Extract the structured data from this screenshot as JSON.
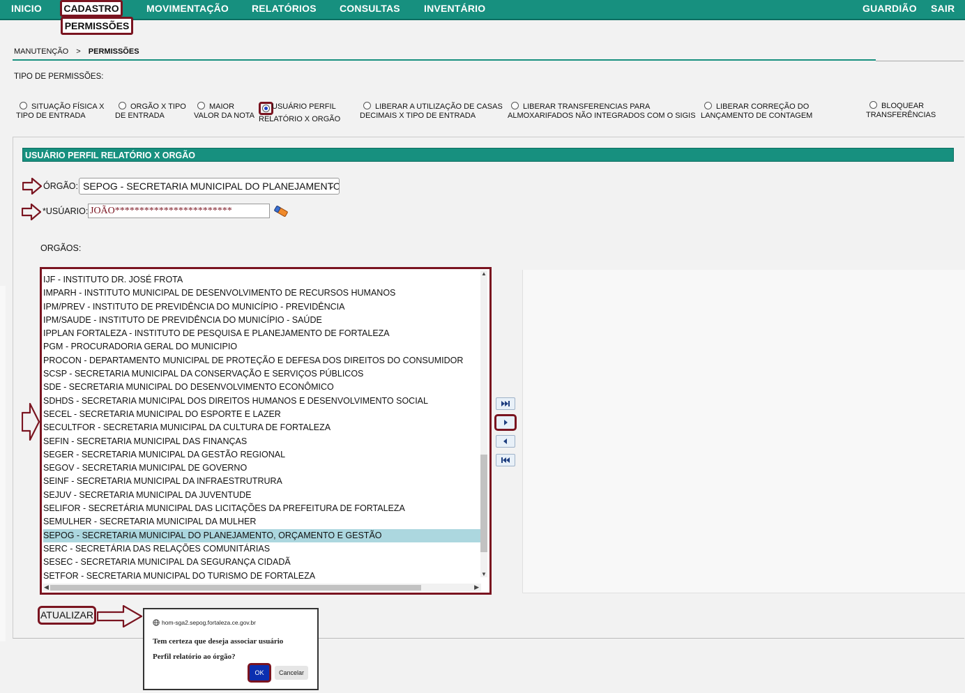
{
  "nav": {
    "items": [
      "INICIO",
      "CADASTRO",
      "MOVIMENTAÇÃO",
      "RELATÓRIOS",
      "CONSULTAS",
      "INVENTÁRIO"
    ],
    "right_items": [
      "GUARDIÃO",
      "SAIR"
    ],
    "submenu_item": "PERMISSÕES"
  },
  "breadcrumb": {
    "parent": "MANUTENÇÃO",
    "separator": ">",
    "current": "PERMISSÕES"
  },
  "permission_types": {
    "label": "TIPO DE PERMISSÕES:",
    "options": [
      {
        "line1": "SITUAÇÃO FÍSICA X",
        "line2": "TIPO DE ENTRADA",
        "checked": false
      },
      {
        "line1": "ORGÃO X TIPO",
        "line2": "DE ENTRADA",
        "checked": false
      },
      {
        "line1": "MAIOR",
        "line2": "VALOR DA NOTA",
        "checked": false
      },
      {
        "line1": "USUÁRIO PERFIL",
        "line2": "RELATÓRIO X ORGÃO",
        "checked": true
      },
      {
        "line1": "LIBERAR A UTILIZAÇÃO DE CASAS",
        "line2": "DECIMAIS X TIPO DE ENTRADA",
        "checked": false
      },
      {
        "line1": "LIBERAR TRANSFERENCIAS PARA",
        "line2": "ALMOXARIFADOS NÃO INTEGRADOS COM O SIGIS",
        "checked": false
      },
      {
        "line1": "LIBERAR CORREÇÃO DO",
        "line2": "LANÇAMENTO DE CONTAGEM",
        "checked": false
      },
      {
        "line1": "BLOQUEAR",
        "line2": "TRANSFERÊNCIAS",
        "checked": false
      }
    ]
  },
  "panel": {
    "title": "USUÁRIO PERFIL RELATÓRIO X ORGÃO",
    "orgao_label": "ÓRGÃO:",
    "orgao_value": "SEPOG - SECRETARIA MUNICIPAL DO PLANEJAMENTO, ORÇAMENTO E GESTÃO",
    "usuario_label": "*USÚARIO:",
    "usuario_value": "JOÃO************************",
    "orgaos_label": "ORGÃOS:",
    "orgaos_list": [
      "IJF - INSTITUTO DR. JOSÉ FROTA",
      "IMPARH - INSTITUTO MUNICIPAL DE DESENVOLVIMENTO DE RECURSOS HUMANOS",
      "IPM/PREV - INSTITUTO DE PREVIDÊNCIA DO MUNICÍPIO - PREVIDÊNCIA",
      "IPM/SAUDE - INSTITUTO DE PREVIDÊNCIA DO MUNICÍPIO - SAÚDE",
      "IPPLAN FORTALEZA - INSTITUTO DE PESQUISA E PLANEJAMENTO DE FORTALEZA",
      "PGM - PROCURADORIA GERAL DO MUNICIPIO",
      "PROCON - DEPARTAMENTO MUNICIPAL DE PROTEÇÃO E DEFESA DOS DIREITOS DO CONSUMIDOR",
      "SCSP - SECRETARIA MUNICIPAL DA CONSERVAÇÃO E SERVIÇOS PÚBLICOS",
      "SDE - SECRETARIA MUNICIPAL DO DESENVOLVIMENTO ECONÔMICO",
      "SDHDS - SECRETARIA MUNICIPAL DOS DIREITOS HUMANOS E DESENVOLVIMENTO SOCIAL",
      "SECEL - SECRETARIA MUNICIPAL DO ESPORTE E LAZER",
      "SECULTFOR - SECRETARIA MUNICIPAL DA CULTURA DE FORTALEZA",
      "SEFIN - SECRETARIA MUNICIPAL DAS FINANÇAS",
      "SEGER - SECRETARIA MUNICIPAL DA GESTÃO REGIONAL",
      "SEGOV - SECRETARIA MUNICIPAL DE GOVERNO",
      "SEINF - SECRETARIA MUNICIPAL DA INFRAESTRUTRURA",
      "SEJUV - SECRETARIA MUNICIPAL DA JUVENTUDE",
      "SELIFOR - SECRETÁRIA MUNICIPAL DAS LICITAÇÕES DA PREFEITURA DE FORTALEZA",
      "SEMULHER - SECRETARIA MUNICIPAL DA MULHER",
      "SEPOG - SECRETARIA MUNICIPAL DO PLANEJAMENTO, ORÇAMENTO E GESTÃO",
      "SERC - SECRETÁRIA DAS RELAÇÕES COMUNITÁRIAS",
      "SESEC - SECRETARIA MUNICIPAL DA SEGURANÇA CIDADÃ",
      "SETFOR - SECRETARIA MUNICIPAL DO TURISMO DE FORTALEZA"
    ],
    "selected_index": 19,
    "atualizar_label": "ATUALIZAR"
  },
  "dialog": {
    "origin": "hom-sga2.sepog.fortaleza.ce.gov.br",
    "message_line1": "Tem certeza que deseja associar usuário",
    "message_line2": "Perfil relatório ao órgão?",
    "ok_label": "OK",
    "cancel_label": "Cancelar"
  },
  "colors": {
    "teal": "#17907f",
    "highlight_border": "#7a1420",
    "selected_row": "#acd7df",
    "ok_button": "#0b2fb0"
  },
  "icons": [
    "arrow-right-outline-icon",
    "eraser-icon",
    "move-all-right-icon",
    "move-right-icon",
    "move-left-icon",
    "move-all-left-icon",
    "globe-icon"
  ]
}
